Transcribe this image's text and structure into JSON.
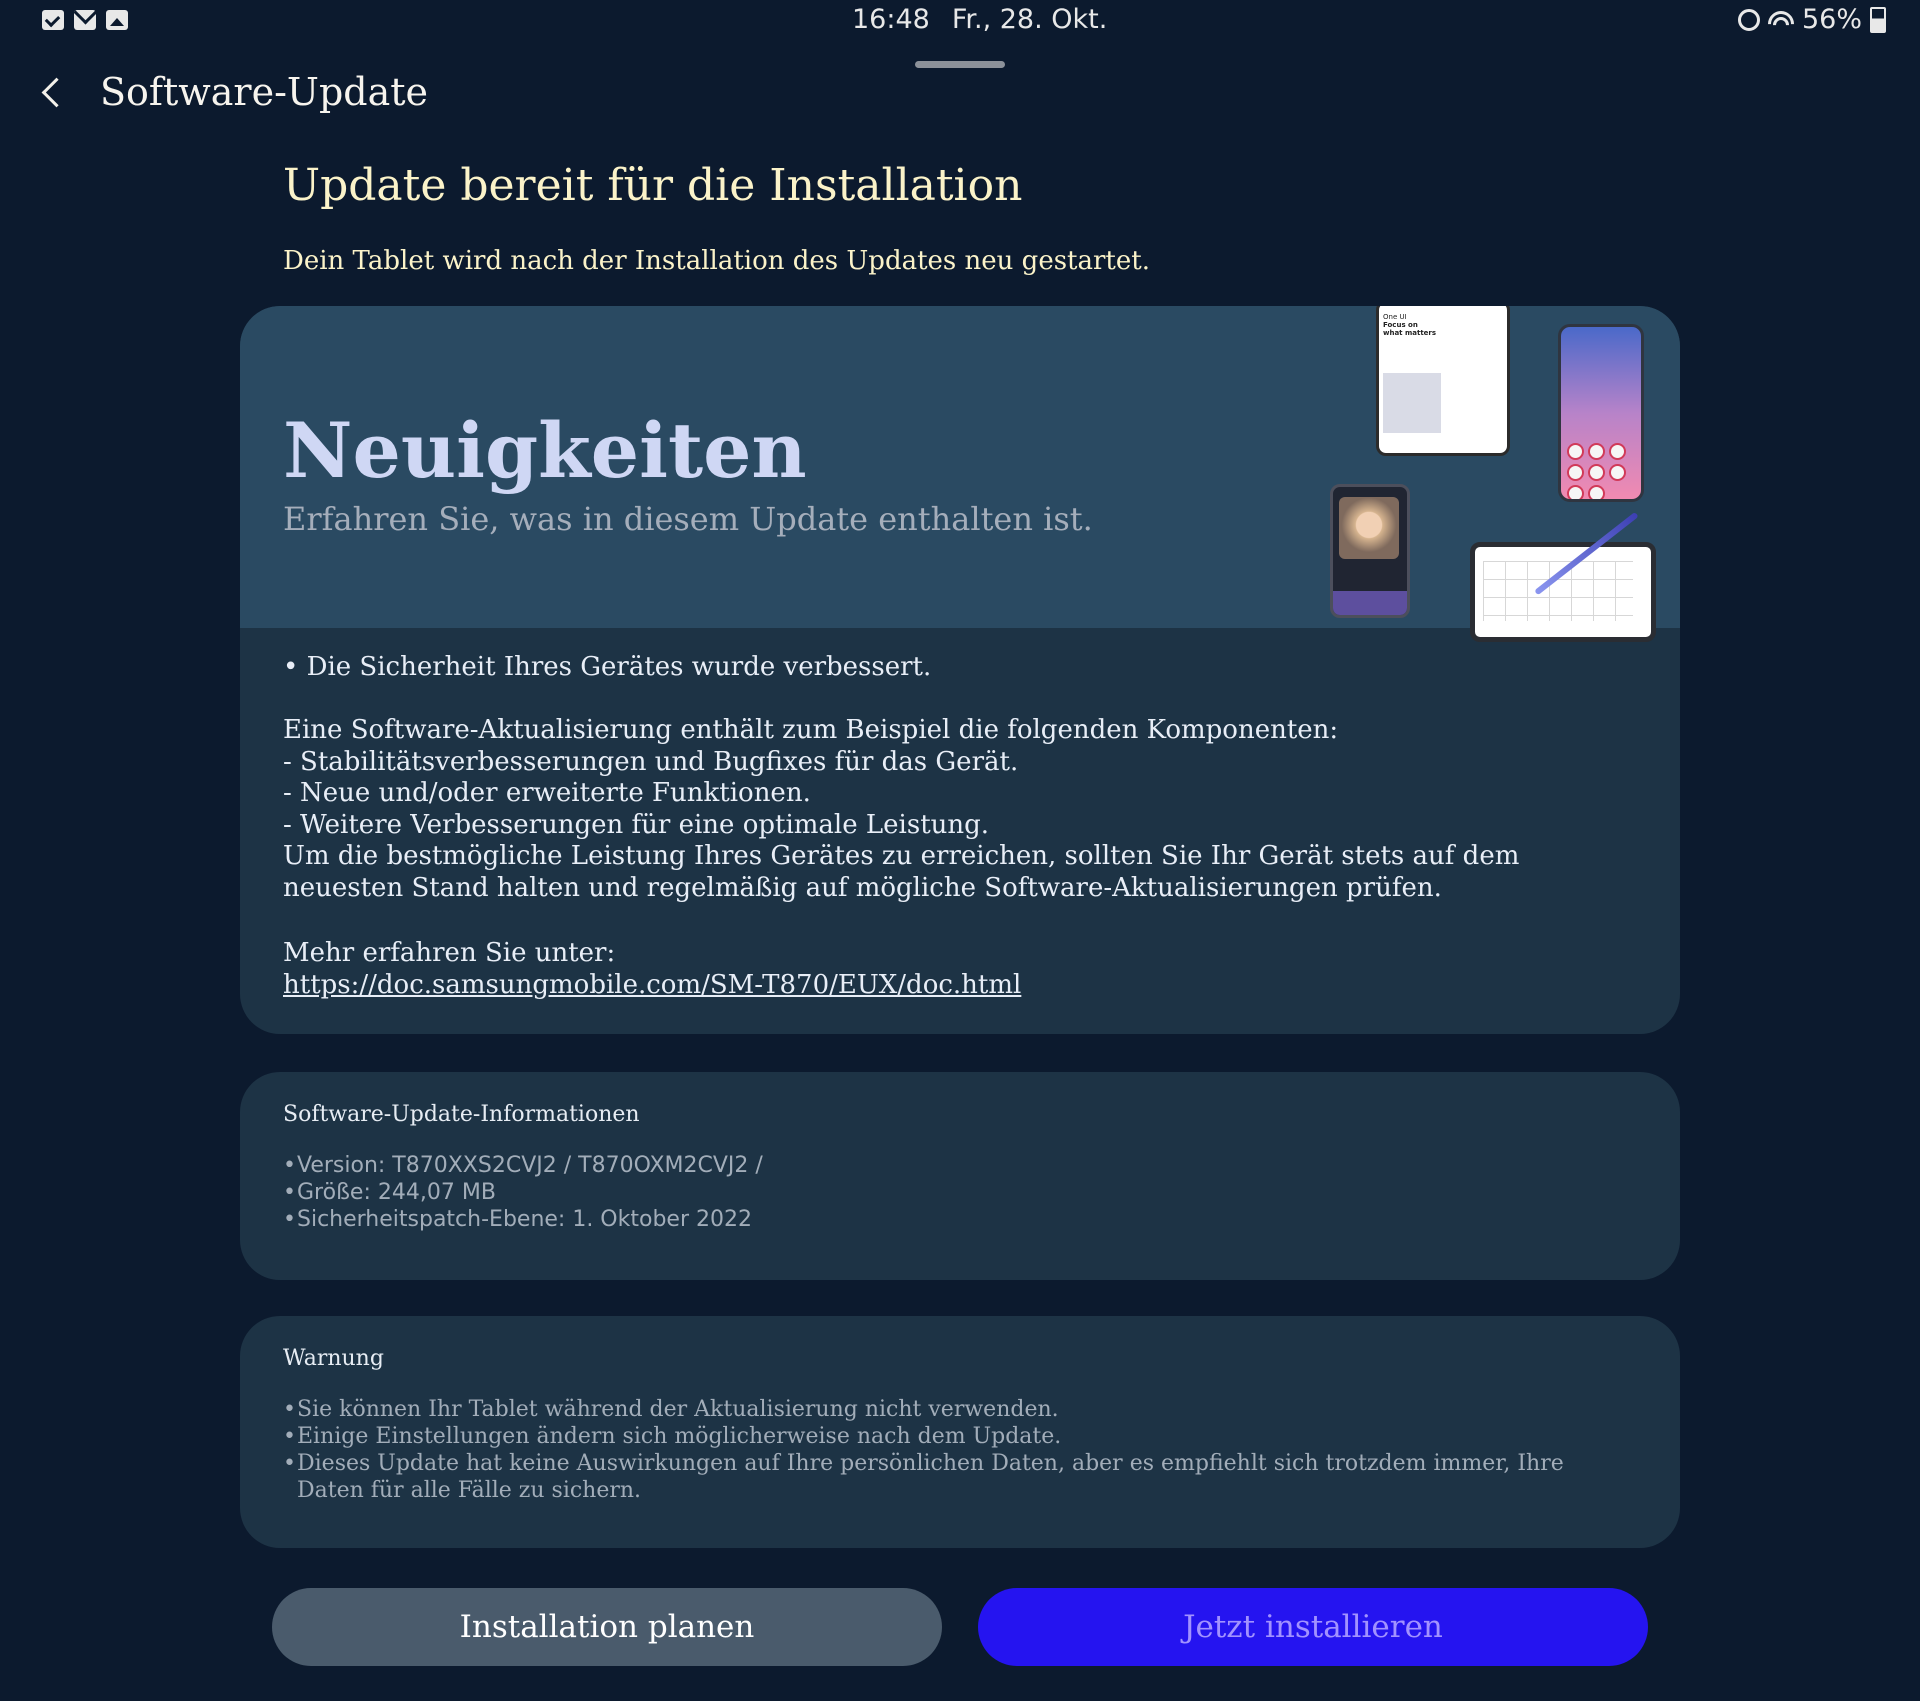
{
  "status_bar": {
    "time": "16:48",
    "date": "Fr., 28. Okt.",
    "battery": "56%",
    "battery_level": 0.56,
    "left_icons": [
      "checklist-icon",
      "mail-icon",
      "image-icon"
    ],
    "right_icons": [
      "alarm-icon",
      "wifi-icon",
      "battery-icon"
    ]
  },
  "header": {
    "title": "Software-Update"
  },
  "main": {
    "heading": "Update bereit für die Installation",
    "subheading": "Dein Tablet wird nach der Installation des Updates neu gestartet."
  },
  "news": {
    "title": "Neuigkeiten",
    "subtitle": "Erfahren Sie, was in diesem Update enthalten ist.",
    "illustration_text": [
      "One UI",
      "Focus on",
      "what matters"
    ],
    "body": "• Die Sicherheit Ihres Gerätes wurde verbessert.\n\nEine Software-Aktualisierung enthält zum Beispiel die folgenden Komponenten:\n - Stabilitätsverbesserungen und Bugfixes für das Gerät.\n - Neue und/oder erweiterte Funktionen.\n - Weitere Verbesserungen für eine optimale Leistung.\nUm die bestmögliche Leistung Ihres Gerätes zu erreichen, sollten Sie Ihr Gerät stets auf dem neuesten Stand halten und regelmäßig auf mögliche Software-Aktualisierungen prüfen.",
    "more_label": "Mehr erfahren Sie unter:",
    "link": "https://doc.samsungmobile.com/SM-T870/EUX/doc.html"
  },
  "info": {
    "heading": "Software-Update-Informationen",
    "items": [
      "Version: T870XXS2CVJ2 / T870OXM2CVJ2 /",
      "Größe: 244,07 MB",
      "Sicherheitspatch-Ebene: 1. Oktober 2022"
    ]
  },
  "warning": {
    "heading": "Warnung",
    "items": [
      "Sie können Ihr Tablet während der Aktualisierung nicht verwenden.",
      "Einige Einstellungen ändern sich möglicherweise nach dem Update.",
      "Dieses Update hat keine Auswirkungen auf Ihre persönlichen Daten, aber es empfiehlt sich trotzdem immer, Ihre Daten für alle Fälle zu sichern."
    ]
  },
  "buttons": {
    "schedule_label": "Installation planen",
    "install_label": "Jetzt installieren"
  },
  "colors": {
    "background": "#0c1a2e",
    "card": "#1d3345",
    "banner": "#2a4a62",
    "heading_text": "#fbf3c9",
    "install_button": "#2514f0",
    "install_text": "#a292ff",
    "schedule_button": "#4a5b6c"
  }
}
